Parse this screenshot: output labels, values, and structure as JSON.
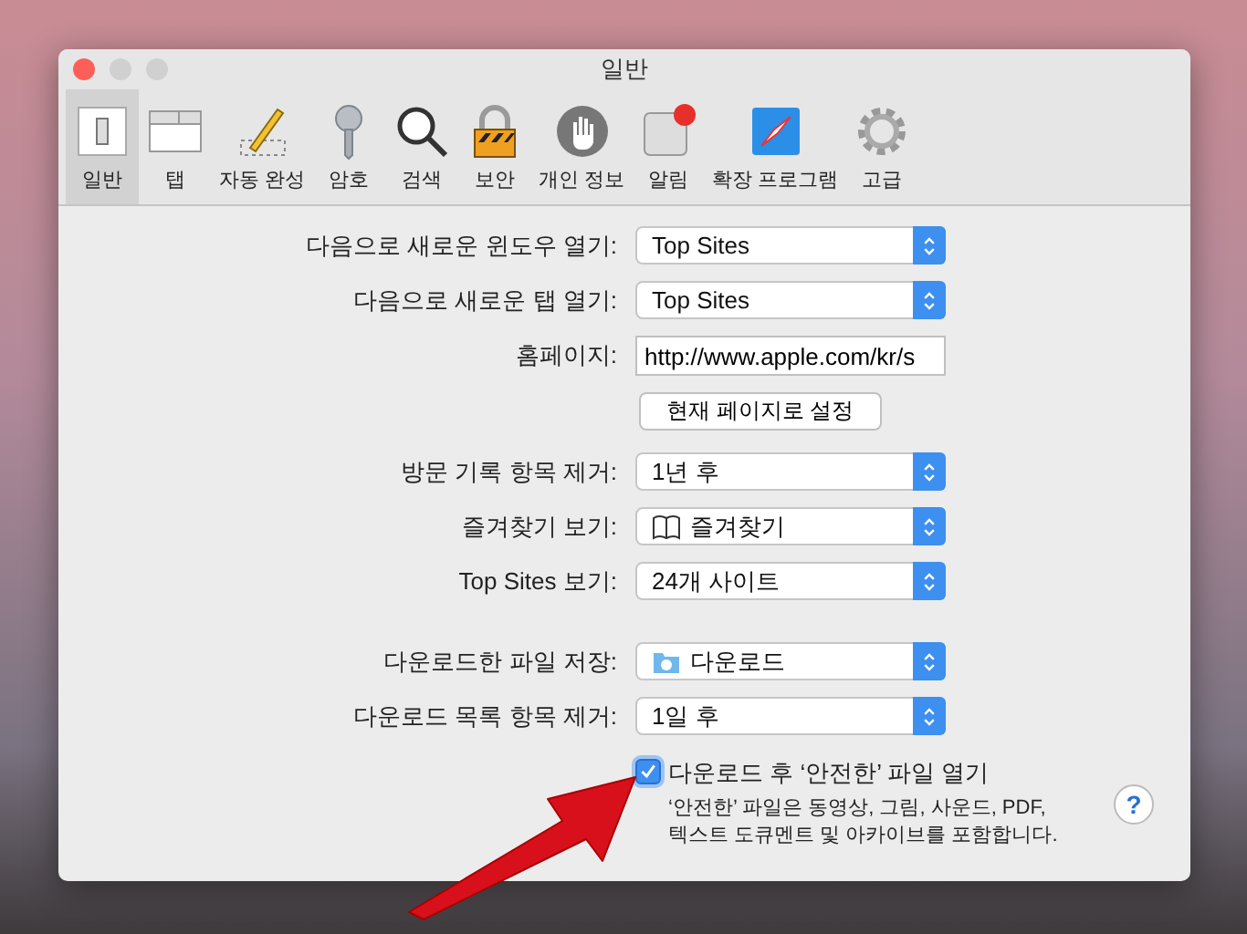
{
  "window": {
    "title": "일반"
  },
  "toolbar": [
    {
      "label": "일반",
      "kind": "switch",
      "selected": true
    },
    {
      "label": "탭",
      "kind": "tabs",
      "selected": false
    },
    {
      "label": "자동 완성",
      "kind": "pencil",
      "selected": false
    },
    {
      "label": "암호",
      "kind": "key",
      "selected": false
    },
    {
      "label": "검색",
      "kind": "magnifier",
      "selected": false
    },
    {
      "label": "보안",
      "kind": "lock",
      "selected": false
    },
    {
      "label": "개인 정보",
      "kind": "hand",
      "selected": false
    },
    {
      "label": "알림",
      "kind": "notification",
      "selected": false
    },
    {
      "label": "확장 프로그램",
      "kind": "compass",
      "selected": false
    },
    {
      "label": "고급",
      "kind": "gear",
      "selected": false
    }
  ],
  "form": {
    "sections": [
      [
        {
          "label": "다음으로 새로운 윈도우 열기:",
          "kind": "popup",
          "value": "Top Sites"
        },
        {
          "label": "다음으로 새로운 탭 열기:",
          "kind": "popup",
          "value": "Top Sites"
        },
        {
          "label": "홈페이지:",
          "kind": "field",
          "value": "http://www.apple.com/kr/s"
        },
        {
          "kind": "button",
          "value": "현재 페이지로 설정"
        }
      ],
      [
        {
          "label": "방문 기록 항목 제거:",
          "kind": "popup",
          "value": "1년 후"
        },
        {
          "label": "즐겨찾기 보기:",
          "kind": "popup",
          "value": "즐겨찾기",
          "icon": {
            "kind": "book"
          }
        },
        {
          "label": "Top Sites 보기:",
          "kind": "popup",
          "value": "24개 사이트"
        }
      ],
      [
        {
          "label": "다운로드한 파일 저장:",
          "kind": "popup",
          "value": "다운로드",
          "icon": {
            "kind": "folder"
          }
        },
        {
          "label": "다운로드 목록 항목 제거:",
          "kind": "popup",
          "value": "1일 후"
        }
      ]
    ]
  },
  "safe_files": {
    "label": "다운로드 후 ‘안전한’ 파일 열기",
    "checked": true,
    "note": [
      "‘안전한’ 파일은 동영상, 그림, 사운드, PDF,",
      "텍스트 도큐멘트 및 아카이브를 포함합니다."
    ]
  },
  "help_button": "?"
}
